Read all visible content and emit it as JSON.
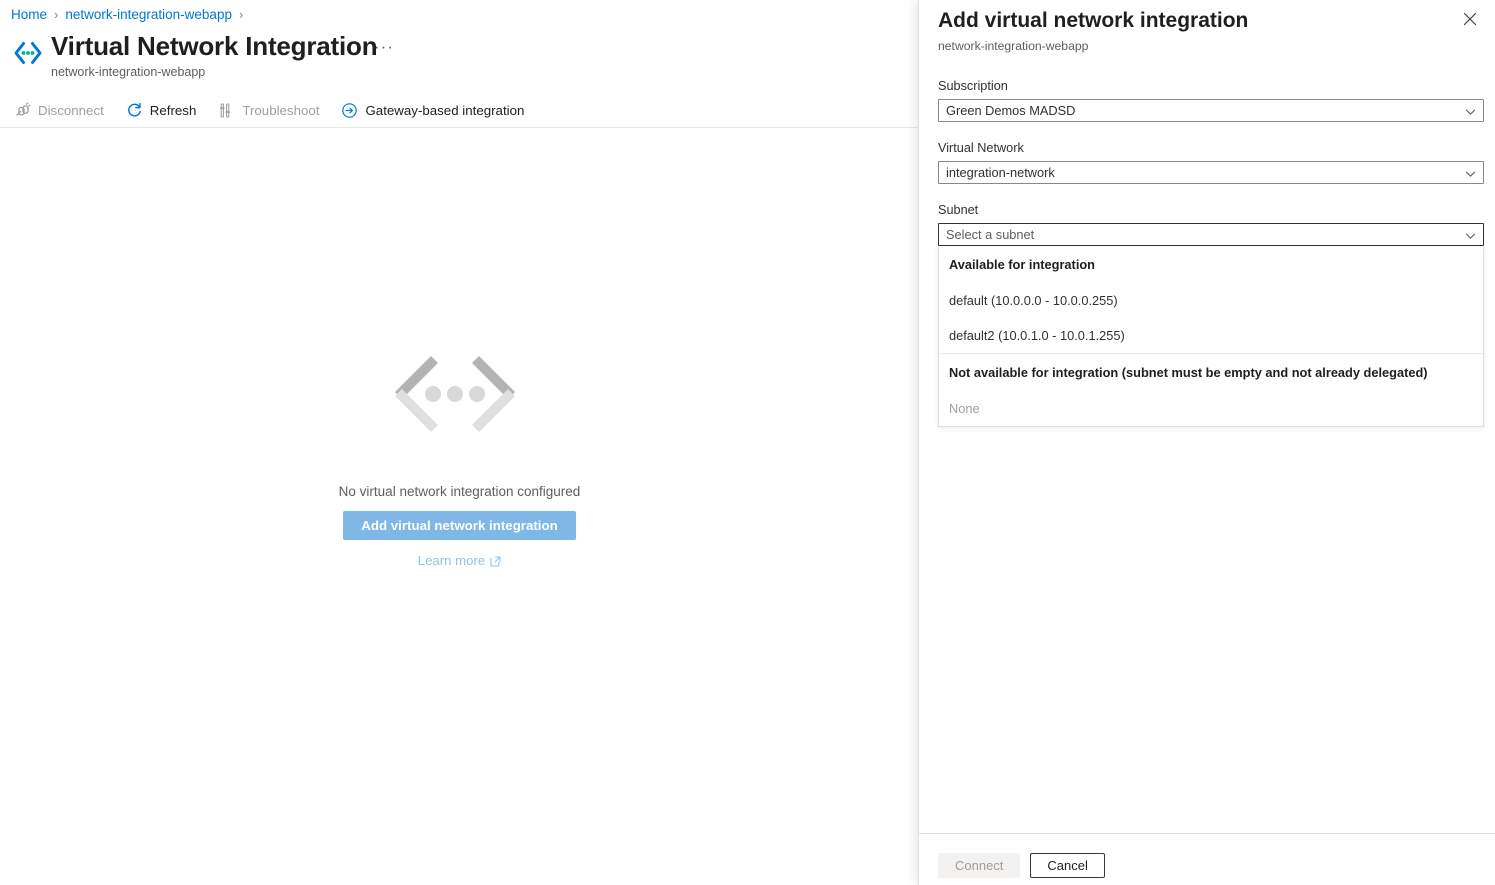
{
  "blade": {
    "breadcrumb": {
      "items": [
        {
          "label": "Home",
          "icon": ""
        },
        {
          "label": "network-integration-webapp",
          "icon": ""
        }
      ],
      "separator": "›"
    },
    "header": {
      "icon": "virtual-network-integration-icon",
      "title": "Virtual Network Integration",
      "subtitle": "network-integration-webapp",
      "ellipsis": "···"
    },
    "toolbar": [
      {
        "label": "Disconnect",
        "icon": "disconnect-icon",
        "enabled": false
      },
      {
        "label": "Refresh",
        "icon": "refresh-icon",
        "enabled": true
      },
      {
        "label": "Troubleshoot",
        "icon": "troubleshoot-icon",
        "enabled": false
      },
      {
        "label": "Gateway-based integration",
        "icon": "arrow-circle-right-icon",
        "enabled": true
      }
    ],
    "empty_state": {
      "icon": "chevron-dots-icon",
      "message": "No virtual network integration configured",
      "primary_button": "Add virtual network integration",
      "link": "Learn more",
      "link_icon": "external-link-icon"
    }
  },
  "panel": {
    "title": "Add virtual network integration",
    "subtitle": "network-integration-webapp",
    "close_icon": "close-icon",
    "fields": {
      "subscription": {
        "label": "Subscription",
        "value": "Green Demos MADSD",
        "chevron_icon": "chevron-down-icon"
      },
      "virtual_network": {
        "label": "Virtual Network",
        "value": "integration-network",
        "chevron_icon": "chevron-down-icon"
      },
      "subnet": {
        "label": "Subnet",
        "placeholder": "Select a subnet",
        "value": "",
        "chevron_icon": "chevron-down-icon",
        "dropdown": {
          "groups": [
            {
              "header": "Available for integration",
              "options": [
                {
                  "label": "default (10.0.0.0 - 10.0.0.255)",
                  "disabled": false
                },
                {
                  "label": "default2 (10.0.1.0 - 10.0.1.255)",
                  "disabled": false
                }
              ]
            },
            {
              "header": "Not available for integration (subnet must be empty and not already delegated)",
              "options": [
                {
                  "label": "None",
                  "disabled": true
                }
              ]
            }
          ]
        }
      }
    },
    "footer": {
      "connect_label": "Connect",
      "connect_enabled": false,
      "cancel_label": "Cancel"
    }
  },
  "colors": {
    "accent": "#0078d4",
    "accent_muted": "#7fb8e6",
    "link": "#0078d4",
    "link_muted": "#8fc1ea",
    "text_primary": "#201f1e",
    "text_secondary": "#605e5c",
    "text_disabled": "#a19f9d",
    "border": "#8a8886",
    "divider": "#e1dfdd",
    "icon_teal": "#00a0a0"
  }
}
